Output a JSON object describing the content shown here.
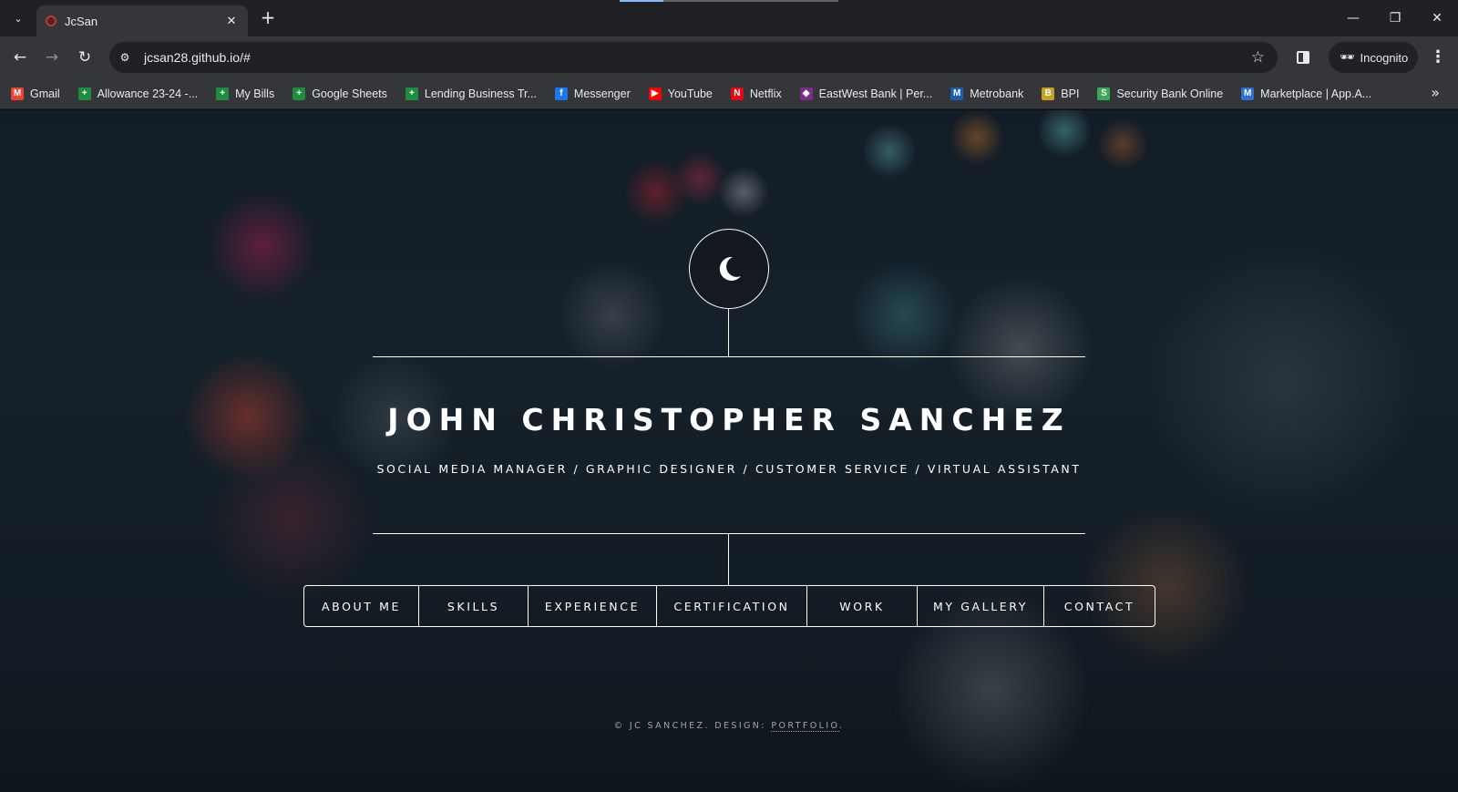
{
  "browser": {
    "tab": {
      "title": "JcSan",
      "close_glyph": "✕"
    },
    "tab_search_glyph": "⌄",
    "new_tab_glyph": "+",
    "window_controls": {
      "minimize": "—",
      "restore": "❐",
      "close": "✕"
    },
    "nav": {
      "back": "←",
      "forward": "→",
      "reload": "↻"
    },
    "omnibox": {
      "site_info_glyph": "⚙",
      "url": "jcsan28.github.io/#",
      "star_glyph": "☆"
    },
    "incognito": {
      "glyph": "🕶",
      "label": "Incognito"
    },
    "menu_glyph": "⋮",
    "load_progress_percent": 20,
    "bookmarks": [
      {
        "label": "Gmail",
        "icon": "gmail-icon",
        "color": "#ea4335",
        "glyph": "M"
      },
      {
        "label": "Allowance 23-24 -...",
        "icon": "sheets-icon",
        "color": "#1e8e3e",
        "glyph": "+"
      },
      {
        "label": "My Bills",
        "icon": "sheets-icon",
        "color": "#1e8e3e",
        "glyph": "+"
      },
      {
        "label": "Google Sheets",
        "icon": "sheets-icon",
        "color": "#1e8e3e",
        "glyph": "+"
      },
      {
        "label": "Lending Business Tr...",
        "icon": "sheets-icon",
        "color": "#1e8e3e",
        "glyph": "+"
      },
      {
        "label": "Messenger",
        "icon": "facebook-icon",
        "color": "#1877f2",
        "glyph": "f"
      },
      {
        "label": "YouTube",
        "icon": "youtube-icon",
        "color": "#ff0000",
        "glyph": "▶"
      },
      {
        "label": "Netflix",
        "icon": "netflix-icon",
        "color": "#e50914",
        "glyph": "N"
      },
      {
        "label": "EastWest Bank | Per...",
        "icon": "eastwest-icon",
        "color": "#7b2c8f",
        "glyph": "◆"
      },
      {
        "label": "Metrobank",
        "icon": "metrobank-icon",
        "color": "#1a5fb4",
        "glyph": "M"
      },
      {
        "label": "BPI",
        "icon": "bpi-icon",
        "color": "#c8a020",
        "glyph": "B"
      },
      {
        "label": "Security Bank Online",
        "icon": "securitybank-icon",
        "color": "#3aa856",
        "glyph": "S"
      },
      {
        "label": "Marketplace | App.A...",
        "icon": "marketplace-icon",
        "color": "#2f6fd6",
        "glyph": "M"
      }
    ],
    "bookmarks_overflow_glyph": "»"
  },
  "site": {
    "logo_icon": "moon-icon",
    "name": "JOHN CHRISTOPHER SANCHEZ",
    "tagline": "SOCIAL MEDIA MANAGER / GRAPHIC DESIGNER / CUSTOMER SERVICE / VIRTUAL ASSISTANT",
    "nav": [
      {
        "label": "ABOUT ME"
      },
      {
        "label": "SKILLS"
      },
      {
        "label": "EXPERIENCE"
      },
      {
        "label": "CERTIFICATION"
      },
      {
        "label": "WORK"
      },
      {
        "label": "MY GALLERY"
      },
      {
        "label": "CONTACT"
      }
    ],
    "footer": {
      "prefix": "© JC SANCHEZ. DESIGN: ",
      "link": "PORTFOLIO",
      "suffix": "."
    }
  },
  "colors": {
    "chrome_dark": "#202124",
    "chrome_mid": "#35363a",
    "chrome_text": "#e8eaed",
    "accent_progress": "#8ab4f8",
    "site_text": "#ffffff"
  }
}
